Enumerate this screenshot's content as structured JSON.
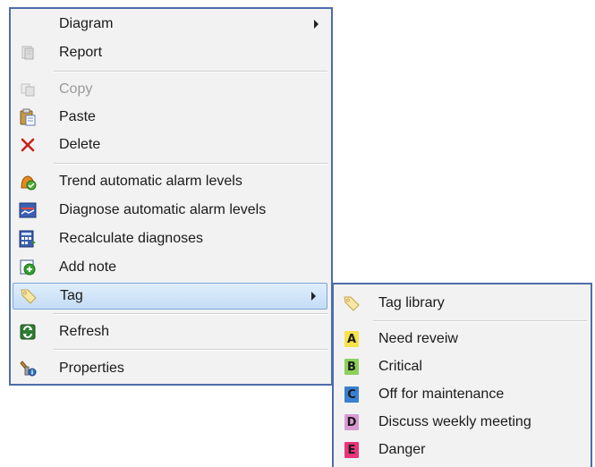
{
  "context_menu": {
    "items": [
      {
        "label": "Diagram",
        "submenu": true
      },
      {
        "label": "Report"
      },
      {
        "label": "Copy",
        "disabled": true
      },
      {
        "label": "Paste"
      },
      {
        "label": "Delete"
      },
      {
        "label": "Trend automatic alarm levels"
      },
      {
        "label": "Diagnose automatic alarm levels"
      },
      {
        "label": "Recalculate diagnoses"
      },
      {
        "label": "Add note"
      },
      {
        "label": "Tag",
        "submenu": true,
        "highlighted": true
      },
      {
        "label": "Refresh"
      },
      {
        "label": "Properties"
      }
    ],
    "icons": [
      "none",
      "report-icon",
      "copy-icon",
      "paste-icon",
      "delete-icon",
      "trend-alarm-icon",
      "diagnose-alarm-icon",
      "recalculate-icon",
      "add-note-icon",
      "tag-icon",
      "refresh-icon",
      "properties-icon"
    ]
  },
  "tag_submenu": {
    "items": [
      {
        "label": "Tag library"
      },
      {
        "label": "Need reveiw",
        "badge": "A",
        "color": "#f6e24b"
      },
      {
        "label": "Critical",
        "badge": "B",
        "color": "#8ccf5a"
      },
      {
        "label": "Off for maintenance",
        "badge": "C",
        "color": "#3a7fd0"
      },
      {
        "label": "Discuss weekly meeting",
        "badge": "D",
        "color": "#d99ad4"
      },
      {
        "label": "Danger",
        "badge": "E",
        "color": "#e8357a"
      }
    ]
  },
  "colors": {
    "menu_border": "#4d6da8",
    "menu_background": "#f2f2f2",
    "highlight": "#c4dcf6",
    "disabled_text": "#9a9a9a",
    "delete_red": "#c8201c"
  }
}
